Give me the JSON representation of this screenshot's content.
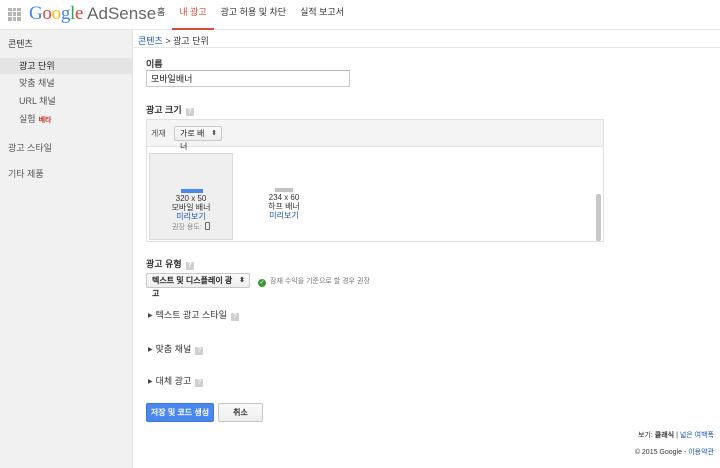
{
  "header": {
    "logo_google": "Google",
    "logo_adsense": "AdSense",
    "nav": [
      "홈",
      "내 광고",
      "광고 허용 및 차단",
      "실적 보고서"
    ],
    "active_nav": 1,
    "accent_color": "#d64b3b"
  },
  "sidebar": {
    "heading": "콘텐츠",
    "items": [
      "광고 단위",
      "맞춤 채널",
      "URL 채널",
      "실험"
    ],
    "beta_badge": "베타",
    "active_item": 0,
    "top_items": [
      "광고 스타일",
      "기타 제품"
    ]
  },
  "breadcrumb": {
    "parent": "콘텐츠",
    "separator": ">",
    "current": "광고 단위"
  },
  "form": {
    "name_label": "이름",
    "name_value": "모바일배너",
    "size_label": "광고 크기",
    "help_glyph": "?",
    "filter_label": "게재",
    "filter_value": "가로 배너",
    "sizes": [
      {
        "dims": "320 x 50",
        "name": "모바일 배너",
        "preview": "미리보기",
        "selected": true
      },
      {
        "dims": "234 x 60",
        "name": "하프 배너",
        "preview": "미리보기",
        "selected": false
      }
    ],
    "recommended_label": "권장 용도:",
    "type_label": "광고 유형",
    "type_value": "텍스트 및 디스플레이 광고",
    "type_note": "잠재 수익을 기준으로 할 경우 권장",
    "sections": [
      "텍스트 광고 스타일",
      "맞춤 채널",
      "대체 광고"
    ]
  },
  "buttons": {
    "save": "저장 및 코드 생성",
    "cancel": "취소"
  },
  "footer": {
    "view_prefix": "보기:",
    "view_current": "클래식",
    "view_sep": "|",
    "view_alt": "넓은 여백폭",
    "copyright": "© 2015 Google -",
    "terms": "이용약관"
  },
  "colors": {
    "link": "#1a55b0",
    "primary_button": "#4a87ee",
    "check_green": "#3c9a3c",
    "beta_red": "#c0392b"
  }
}
